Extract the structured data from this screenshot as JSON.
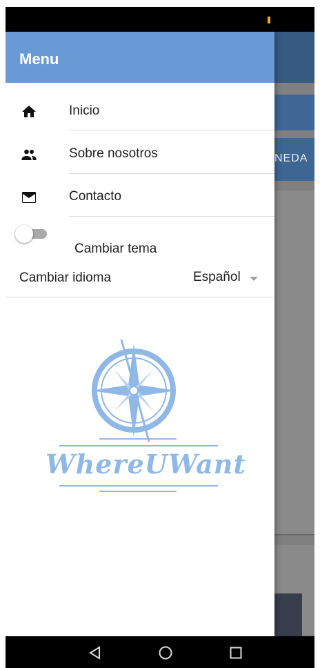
{
  "drawer": {
    "title": "Menu",
    "items": [
      {
        "label": "Inicio",
        "icon": "home-icon"
      },
      {
        "label": "Sobre nosotros",
        "icon": "people-icon"
      },
      {
        "label": "Contacto",
        "icon": "mail-icon"
      }
    ],
    "theme_toggle": {
      "label": "Cambiar tema",
      "on": false
    },
    "language": {
      "label": "Cambiar idioma",
      "selected": "Español"
    },
    "logo_text": "WhereUWant"
  },
  "background": {
    "tab_fragment": "NEDA"
  },
  "colors": {
    "header": "#6a9ad6",
    "logo": "#8fb8e6",
    "statusbar": "#000000"
  },
  "navbar": {
    "buttons": [
      "back-icon",
      "home-circle-icon",
      "recents-icon"
    ]
  }
}
